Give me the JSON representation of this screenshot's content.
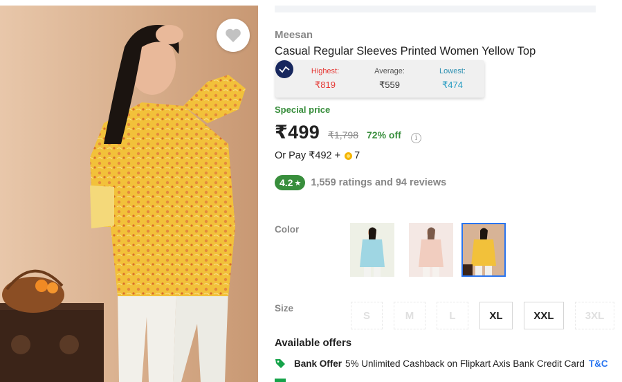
{
  "product": {
    "brand": "Meesan",
    "title": "Casual Regular Sleeves Printed Women Yellow Top"
  },
  "price_history": {
    "highest_label": "Highest:",
    "highest_value": "₹819",
    "average_label": "Average:",
    "average_value": "₹559",
    "lowest_label": "Lowest:",
    "lowest_value": "₹474"
  },
  "pricing": {
    "special_label": "Special price",
    "price": "₹499",
    "mrp": "₹1,798",
    "discount": "72% off",
    "info_icon": "i",
    "or_pay": "Or Pay ₹492 +",
    "coins": "7"
  },
  "rating": {
    "score": "4.2",
    "star": "★",
    "summary": "1,559 ratings and 94 reviews"
  },
  "color": {
    "label": "Color",
    "options": [
      "Blue",
      "Peach",
      "Yellow"
    ],
    "selected": "Yellow"
  },
  "size": {
    "label": "Size",
    "options": [
      "S",
      "M",
      "L",
      "XL",
      "XXL",
      "3XL"
    ],
    "available": [
      "XL",
      "XXL"
    ]
  },
  "offers": {
    "heading": "Available offers",
    "items": [
      {
        "title": "Bank Offer",
        "text": "5% Unlimited Cashback on Flipkart Axis Bank Credit Card",
        "link": "T&C"
      }
    ]
  },
  "icons": [
    "heart-icon",
    "price-history-logo-icon",
    "info-icon",
    "supercoin-icon",
    "star-icon",
    "offer-tag-icon"
  ],
  "colors": {
    "accent_green": "#388e3c",
    "link_blue": "#2874f0",
    "muted_gray": "#878787",
    "highest_red": "#e53935",
    "lowest_blue": "#1f99c0",
    "product_yellow": "#f2c13a"
  }
}
